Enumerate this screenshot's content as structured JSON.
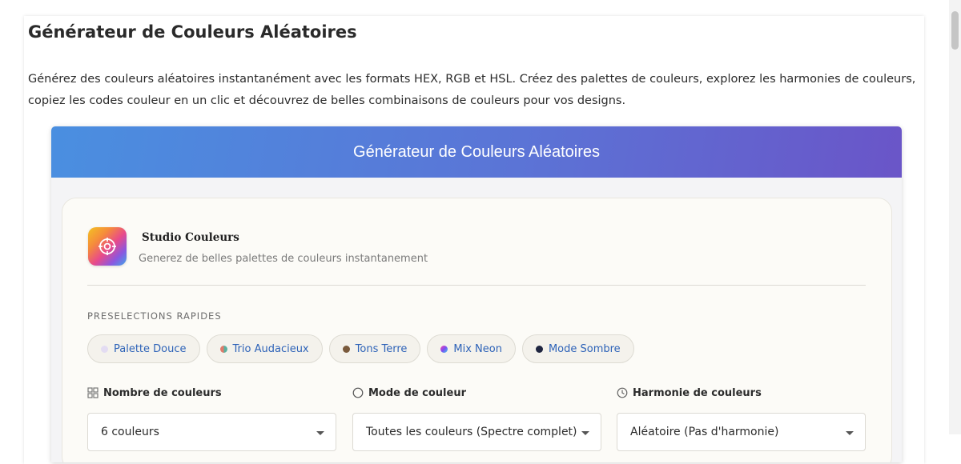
{
  "page": {
    "title": "Générateur de Couleurs Aléatoires",
    "description": "Générez des couleurs aléatoires instantanément avec les formats HEX, RGB et HSL. Créez des palettes de couleurs, explorez les harmonies de couleurs, copiez les codes couleur en un clic et découvrez de belles combinaisons de couleurs pour vos designs."
  },
  "app": {
    "header_title": "Générateur de Couleurs Aléatoires",
    "studio": {
      "name": "Studio Couleurs",
      "subtitle": "Generez de belles palettes de couleurs instantanement",
      "logo_icon": "target-icon"
    },
    "presets": {
      "label": "PRESELECTIONS RAPIDES",
      "items": [
        {
          "label": "Palette Douce",
          "dot_color": "#e3dcf2"
        },
        {
          "label": "Trio Audacieux",
          "dot_color": "#c98a7a"
        },
        {
          "label": "Tons Terre",
          "dot_color": "#7a5a3c"
        },
        {
          "label": "Mix Neon",
          "dot_color": "#b24ef0"
        },
        {
          "label": "Mode Sombre",
          "dot_color": "#1f2540"
        }
      ]
    },
    "controls": {
      "count": {
        "label": "Nombre de couleurs",
        "icon": "grid-icon",
        "value": "6 couleurs"
      },
      "mode": {
        "label": "Mode de couleur",
        "icon": "circle-icon",
        "value": "Toutes les couleurs (Spectre complet)"
      },
      "harmony": {
        "label": "Harmonie de couleurs",
        "icon": "clock-icon",
        "value": "Aléatoire (Pas d'harmonie)"
      }
    }
  },
  "colors": {
    "accent": "#2e63b8",
    "header_start": "#4a8fe0",
    "header_end": "#6a55c8"
  }
}
